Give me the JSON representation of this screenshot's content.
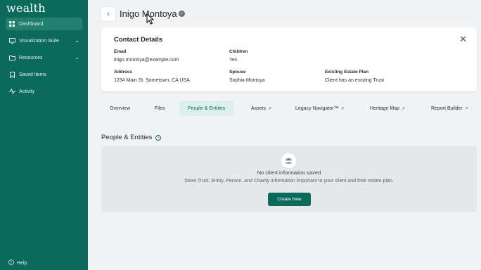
{
  "brand": "wealth",
  "sidebar": {
    "items": [
      {
        "label": "Dashboard"
      },
      {
        "label": "Visualization Suite"
      },
      {
        "label": "Resources"
      },
      {
        "label": "Saved Items"
      },
      {
        "label": "Activity"
      }
    ],
    "help_label": "Help"
  },
  "header": {
    "client_name": "Inigo Montoya"
  },
  "contact": {
    "title": "Contact Details",
    "email_label": "Email",
    "email": "inigo.montoya@example.com",
    "children_label": "Children",
    "children": "Yes",
    "address_label": "Address",
    "address": "1234 Main St. Sometown, CA USA",
    "spouse_label": "Spouse",
    "spouse": "Sophia Montoya",
    "plan_label": "Existing Estate Plan",
    "plan": "Client has an existing Trust"
  },
  "tabs": [
    {
      "label": "Overview"
    },
    {
      "label": "Files"
    },
    {
      "label": "People & Entities"
    },
    {
      "label": "Assets"
    },
    {
      "label": "Legacy Navigator™"
    },
    {
      "label": "Heritage Map"
    },
    {
      "label": "Report Builder"
    }
  ],
  "section": {
    "title": "People & Entities",
    "empty_title": "No client information saved",
    "empty_sub": "Store Trust, Entity, Person, and Charity information important to your client and their estate plan.",
    "create_label": "Create New"
  },
  "colors": {
    "brand": "#0b6a5c",
    "active_tab_bg": "#dcefeb"
  }
}
